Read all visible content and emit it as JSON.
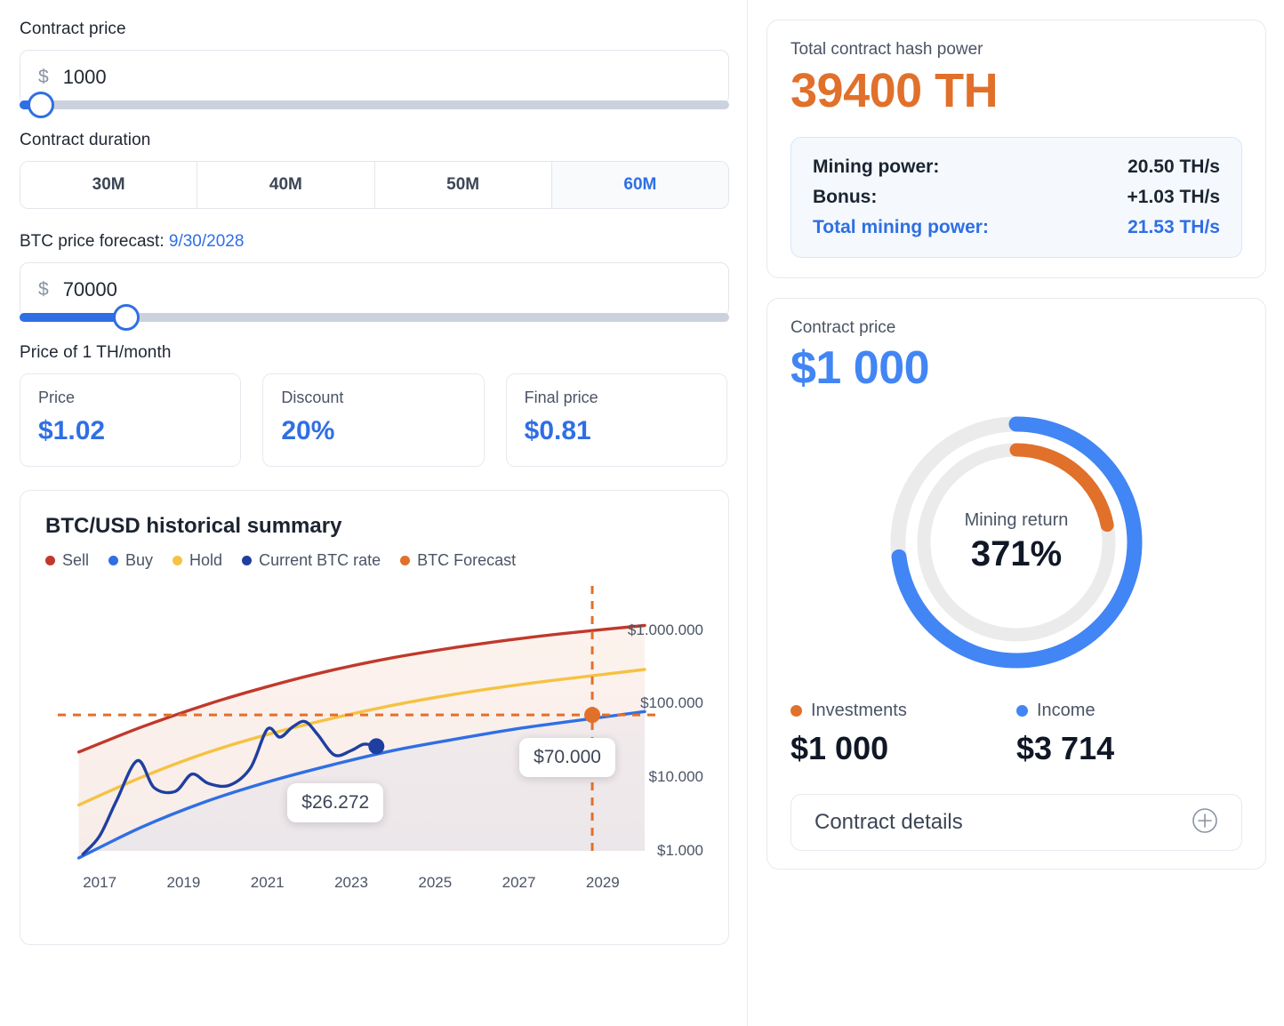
{
  "left": {
    "contract_price": {
      "label": "Contract price",
      "currency_symbol": "$",
      "value": "1000",
      "slider_percent": 3
    },
    "contract_duration": {
      "label": "Contract duration",
      "options": [
        {
          "label": "30M",
          "active": false
        },
        {
          "label": "40M",
          "active": false
        },
        {
          "label": "50M",
          "active": false
        },
        {
          "label": "60M",
          "active": true
        }
      ]
    },
    "btc_forecast": {
      "label": "BTC price forecast:",
      "date": "9/30/2028",
      "currency_symbol": "$",
      "value": "70000",
      "slider_percent": 15
    },
    "price_per_th": {
      "label": "Price of 1 TH/month",
      "cards": [
        {
          "label": "Price",
          "value": "$1.02"
        },
        {
          "label": "Discount",
          "value": "20%"
        },
        {
          "label": "Final price",
          "value": "$0.81"
        }
      ]
    }
  },
  "chart_data": {
    "type": "line",
    "title": "BTC/USD historical summary",
    "xlabel": "",
    "ylabel": "",
    "grid": false,
    "legend_position": "top",
    "legend": [
      {
        "name": "Sell",
        "color": "#c0392b"
      },
      {
        "name": "Buy",
        "color": "#2f6fe4"
      },
      {
        "name": "Hold",
        "color": "#f5c242"
      },
      {
        "name": "Current BTC rate",
        "color": "#1f3fa0"
      },
      {
        "name": "BTC Forecast",
        "color": "#e1702b"
      }
    ],
    "x_ticks": [
      "2017",
      "2019",
      "2021",
      "2023",
      "2025",
      "2027",
      "2029"
    ],
    "y_ticks": [
      "$1.000.000",
      "$100.000",
      "$10.000",
      "$1.000"
    ],
    "y_scale": "log",
    "ylim": [
      1000,
      3000000
    ],
    "xlim": [
      2016,
      2030
    ],
    "annotations": [
      {
        "label": "$26.272",
        "series": "Current BTC rate",
        "x": 2023.6,
        "y": 26272
      },
      {
        "label": "$70.000",
        "series": "BTC Forecast",
        "x": 2028.75,
        "y": 70000
      }
    ],
    "series": [
      {
        "name": "Sell",
        "color": "#c0392b",
        "x": [
          2016.5,
          2018,
          2019.5,
          2021,
          2022.5,
          2024,
          2025.5,
          2027,
          2028.5,
          2030
        ],
        "y": [
          22000,
          48000,
          95000,
          170000,
          280000,
          420000,
          580000,
          760000,
          950000,
          1150000
        ]
      },
      {
        "name": "Hold",
        "color": "#f5c242",
        "x": [
          2016.5,
          2018,
          2019.5,
          2021,
          2022.5,
          2024,
          2025.5,
          2027,
          2028.5,
          2030
        ],
        "y": [
          4200,
          10000,
          21000,
          38000,
          62000,
          95000,
          135000,
          180000,
          230000,
          290000
        ]
      },
      {
        "name": "Buy",
        "color": "#2f6fe4",
        "x": [
          2016.5,
          2018,
          2019.5,
          2021,
          2022.5,
          2024,
          2025.5,
          2027,
          2028.5,
          2030
        ],
        "y": [
          800,
          2100,
          4600,
          8600,
          14500,
          23000,
          33000,
          46000,
          60000,
          78000
        ]
      },
      {
        "name": "Current BTC rate",
        "color": "#1f3fa0",
        "x": [
          2016.6,
          2017.0,
          2017.4,
          2017.9,
          2018.3,
          2018.8,
          2019.2,
          2019.6,
          2020.1,
          2020.6,
          2021.0,
          2021.3,
          2021.6,
          2021.9,
          2022.2,
          2022.6,
          2023.0,
          2023.3,
          2023.6
        ],
        "y": [
          900,
          1600,
          4800,
          16800,
          7200,
          6400,
          11000,
          8200,
          7800,
          13500,
          45000,
          35000,
          48000,
          57000,
          38000,
          20000,
          23000,
          28000,
          26272
        ]
      }
    ]
  },
  "right": {
    "hash_power": {
      "label": "Total contract hash power",
      "value": "39400 TH"
    },
    "power_details": [
      {
        "key": "Mining power:",
        "value": "20.50 TH/s",
        "highlight": false
      },
      {
        "key": "Bonus:",
        "value": "+1.03 TH/s",
        "highlight": false
      },
      {
        "key": "Total mining power:",
        "value": "21.53 TH/s",
        "highlight": true
      }
    ],
    "contract": {
      "label": "Contract price",
      "value": "$1 000"
    },
    "donut": {
      "caption": "Mining return",
      "value": "371%",
      "outer_percent": 73,
      "inner_percent": 22,
      "outer_color": "#4285f4",
      "inner_color": "#e1702b",
      "track_color": "#ebebeb"
    },
    "totals": [
      {
        "label": "Investments",
        "value": "$1 000",
        "color": "#e1702b"
      },
      {
        "label": "Income",
        "value": "$3 714",
        "color": "#4285f4"
      }
    ],
    "details_bar": {
      "label": "Contract details",
      "icon": "plus-circle-icon"
    }
  }
}
